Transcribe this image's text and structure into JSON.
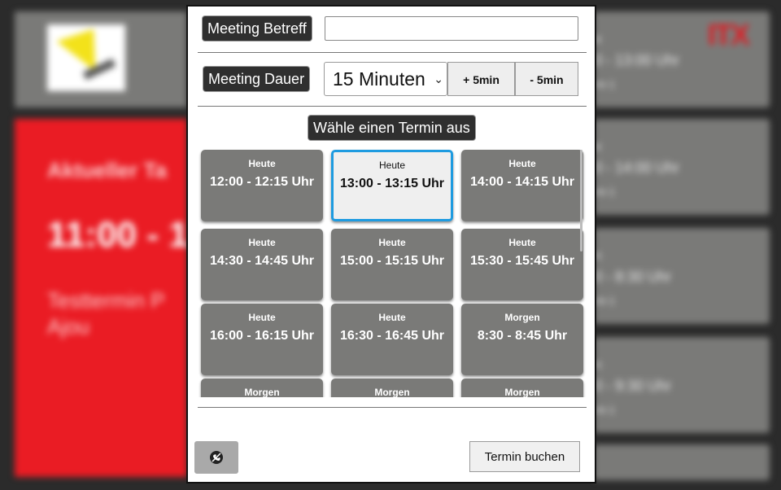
{
  "background": {
    "current_title": "Aktueller Ta",
    "current_time": "11:00 - 1",
    "current_subject_1": "Testtermin P",
    "current_subject_2": "Ajou",
    "right_cards": [
      {
        "r1": "e",
        "r2": "0 - 13:00 Uhr",
        "r3": "rm 1"
      },
      {
        "r1": "e",
        "r2": "0 - 14:00 Uhr",
        "r3": "rm 1"
      },
      {
        "r1": "n",
        "r2": "0 - 8:30 Uhr",
        "r3": "rm 1"
      },
      {
        "r1": "n",
        "r2": "0 - 9:30 Uhr",
        "r3": "rm 1"
      },
      {
        "r1": "",
        "r2": "",
        "r3": ""
      }
    ],
    "brand": "ITX"
  },
  "dialog": {
    "subject_label": "Meeting Betreff",
    "subject_value": "",
    "duration_label": "Meeting Dauer",
    "duration_value": "15 Minuten",
    "plus_label": "+ 5min",
    "minus_label": "- 5min",
    "choose_label": "Wähle einen Termin aus",
    "slots": [
      {
        "day": "Heute",
        "time": "12:00 - 12:15 Uhr",
        "selected": false
      },
      {
        "day": "Heute",
        "time": "13:00 - 13:15 Uhr",
        "selected": true
      },
      {
        "day": "Heute",
        "time": "14:00 - 14:15 Uhr",
        "selected": false
      },
      {
        "day": "Heute",
        "time": "14:30 - 14:45 Uhr",
        "selected": false
      },
      {
        "day": "Heute",
        "time": "15:00 - 15:15 Uhr",
        "selected": false
      },
      {
        "day": "Heute",
        "time": "15:30 - 15:45 Uhr",
        "selected": false
      },
      {
        "day": "Heute",
        "time": "16:00 - 16:15 Uhr",
        "selected": false
      },
      {
        "day": "Heute",
        "time": "16:30 - 16:45 Uhr",
        "selected": false
      },
      {
        "day": "Morgen",
        "time": "8:30 - 8:45 Uhr",
        "selected": false
      },
      {
        "day": "Morgen",
        "time": "",
        "selected": false
      },
      {
        "day": "Morgen",
        "time": "",
        "selected": false
      },
      {
        "day": "Morgen",
        "time": "",
        "selected": false
      }
    ],
    "book_label": "Termin buchen",
    "left_button_icon": "cancel-call-icon"
  },
  "colors": {
    "slot_bg": "#7a7a78",
    "selected_border": "#1e9be0",
    "current_bg": "#ea1c24"
  }
}
